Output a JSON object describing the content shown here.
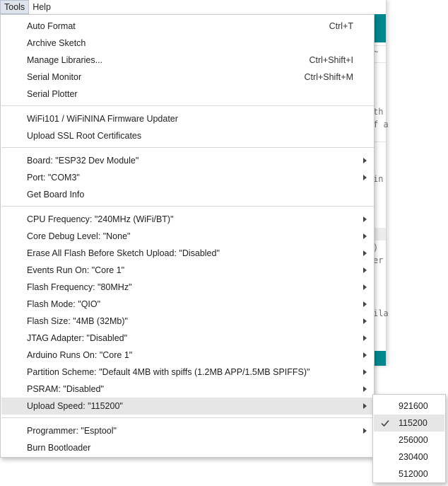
{
  "menubar": {
    "items": [
      {
        "label": "Tools",
        "active": true
      },
      {
        "label": "Help",
        "active": false
      }
    ]
  },
  "background": {
    "code_fragments": [
      "~",
      "th",
      "f a",
      "in",
      ")",
      "er",
      "ila"
    ]
  },
  "tools_menu": {
    "groups": [
      {
        "items": [
          {
            "label": "Auto Format",
            "shortcut": "Ctrl+T"
          },
          {
            "label": "Archive Sketch",
            "shortcut": ""
          },
          {
            "label": "Manage Libraries...",
            "shortcut": "Ctrl+Shift+I"
          },
          {
            "label": "Serial Monitor",
            "shortcut": "Ctrl+Shift+M"
          },
          {
            "label": "Serial Plotter",
            "shortcut": ""
          }
        ]
      },
      {
        "items": [
          {
            "label": "WiFi101 / WiFiNINA Firmware Updater",
            "shortcut": ""
          },
          {
            "label": "Upload SSL Root Certificates",
            "shortcut": ""
          }
        ]
      },
      {
        "items": [
          {
            "label": "Board: \"ESP32 Dev Module\"",
            "submenu": true
          },
          {
            "label": "Port: \"COM3\"",
            "submenu": true
          },
          {
            "label": "Get Board Info",
            "submenu": false
          }
        ]
      },
      {
        "items": [
          {
            "label": "CPU Frequency: \"240MHz (WiFi/BT)\"",
            "submenu": true
          },
          {
            "label": "Core Debug Level: \"None\"",
            "submenu": true
          },
          {
            "label": "Erase All Flash Before Sketch Upload: \"Disabled\"",
            "submenu": true
          },
          {
            "label": "Events Run On: \"Core 1\"",
            "submenu": true
          },
          {
            "label": "Flash Frequency: \"80MHz\"",
            "submenu": true
          },
          {
            "label": "Flash Mode: \"QIO\"",
            "submenu": true
          },
          {
            "label": "Flash Size: \"4MB (32Mb)\"",
            "submenu": true
          },
          {
            "label": "JTAG Adapter: \"Disabled\"",
            "submenu": true
          },
          {
            "label": "Arduino Runs On: \"Core 1\"",
            "submenu": true
          },
          {
            "label": "Partition Scheme: \"Default 4MB with spiffs (1.2MB APP/1.5MB SPIFFS)\"",
            "submenu": true
          },
          {
            "label": "PSRAM: \"Disabled\"",
            "submenu": true
          },
          {
            "label": "Upload Speed: \"115200\"",
            "submenu": true,
            "highlighted": true
          }
        ]
      },
      {
        "items": [
          {
            "label": "Programmer: \"Esptool\"",
            "submenu": true
          },
          {
            "label": "Burn Bootloader",
            "submenu": false
          }
        ]
      }
    ]
  },
  "upload_speed_submenu": {
    "options": [
      {
        "label": "921600",
        "selected": false
      },
      {
        "label": "115200",
        "selected": true
      },
      {
        "label": "256000",
        "selected": false
      },
      {
        "label": "230400",
        "selected": false
      },
      {
        "label": "512000",
        "selected": false
      }
    ]
  },
  "colors": {
    "teal_accent": "#00878f",
    "highlight_bg": "#e6e6e6",
    "menubar_active_bg": "#dfe4ec"
  }
}
